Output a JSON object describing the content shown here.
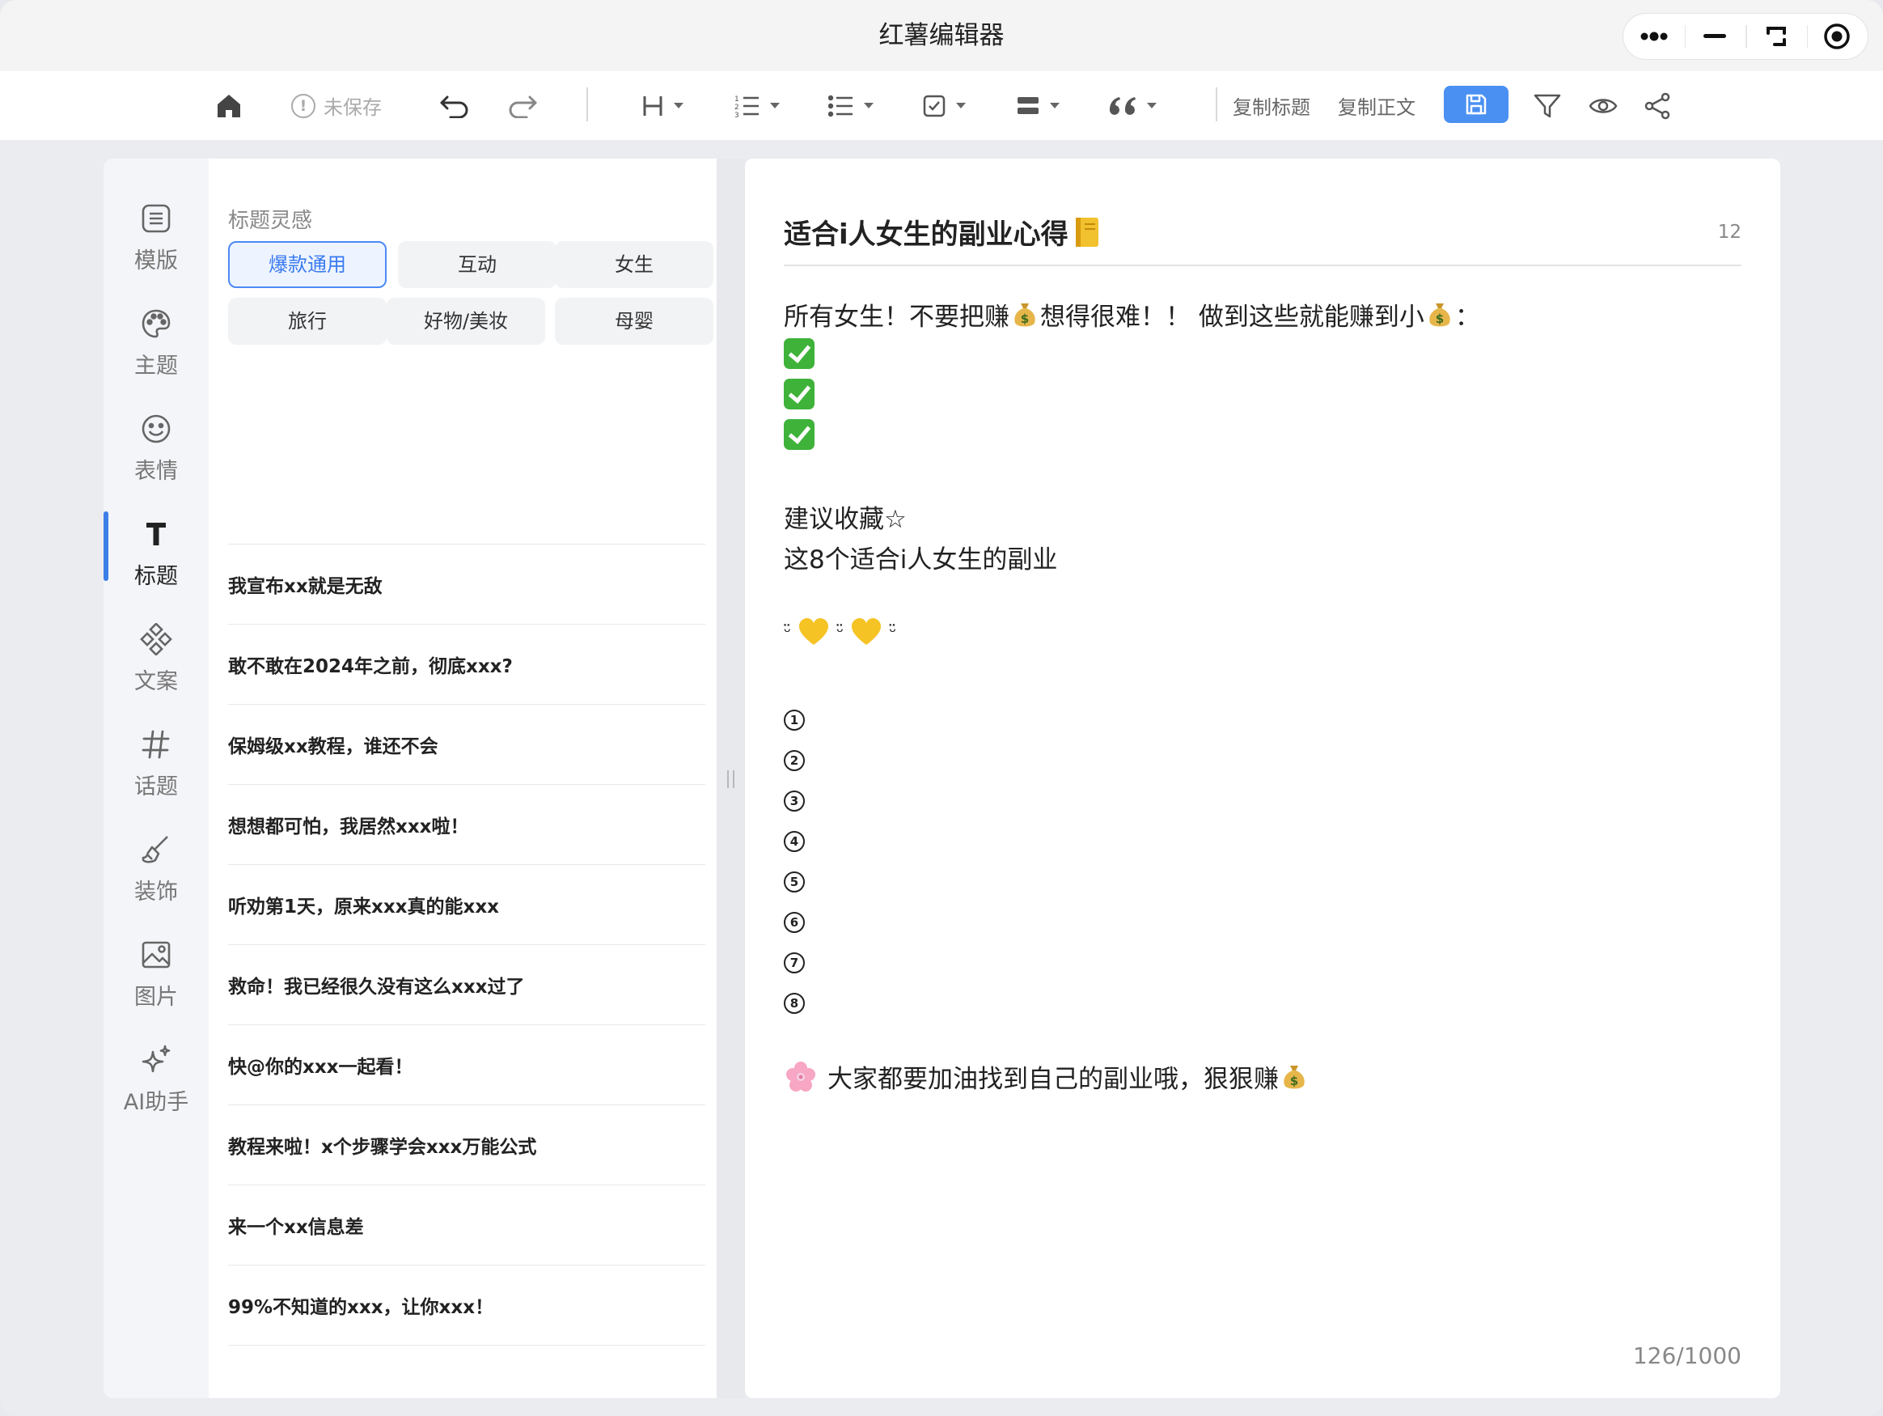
{
  "app": {
    "title": "红薯编辑器"
  },
  "toolbar": {
    "unsaved_label": "未保存",
    "copy_title_label": "复制标题",
    "copy_body_label": "复制正文"
  },
  "nav": {
    "items": [
      {
        "label": "模版",
        "icon": "template-icon"
      },
      {
        "label": "主题",
        "icon": "palette-icon"
      },
      {
        "label": "表情",
        "icon": "smiley-icon"
      },
      {
        "label": "标题",
        "icon": "text-t-icon",
        "active": true
      },
      {
        "label": "文案",
        "icon": "copywriting-icon"
      },
      {
        "label": "话题",
        "icon": "hashtag-icon"
      },
      {
        "label": "装饰",
        "icon": "brush-icon"
      },
      {
        "label": "图片",
        "icon": "image-icon"
      },
      {
        "label": "AI助手",
        "icon": "sparkle-icon"
      }
    ]
  },
  "inspiration": {
    "heading": "标题灵感",
    "tags": [
      "爆款通用",
      "互动",
      "女生",
      "旅行",
      "好物/美妆",
      "母婴"
    ],
    "active_tag": "爆款通用",
    "titles": [
      "我宣布xx就是无敌",
      "敢不敢在2024年之前，彻底xxx?",
      "保姆级xx教程，谁还不会",
      "想想都可怕，我居然xxx啦！",
      "听劝第1天，原来xxx真的能xxx",
      "救命！我已经很久没有这么xxx过了",
      "快@你的xxx一起看！",
      "教程来啦！x个步骤学会xxx万能公式",
      "来一个xx信息差",
      "99%不知道的xxx，让你xxx！"
    ]
  },
  "editor": {
    "title": "适合i人女生的副业心得",
    "title_count": "12",
    "line1_a": "所有女生！不要把赚",
    "line1_b": "想得很难！！ 做到这些就能赚到小",
    "line1_c": "：",
    "line_collect": "建议收藏☆",
    "line_subtitle": " 这8个适合i人女生的副业",
    "deco_a": "ᵕ̈",
    "deco_b": "ᵕ̈",
    "deco_c": "ᵕ̈",
    "numbers": [
      "1",
      "2",
      "3",
      "4",
      "5",
      "6",
      "7",
      "8"
    ],
    "closing_a": "大家都要加油找到自己的副业哦，狠狠赚",
    "char_count": "126/1000"
  },
  "colors": {
    "accent": "#3d7fe8",
    "save_button": "#4a90f2",
    "check": "#3fb23a"
  }
}
